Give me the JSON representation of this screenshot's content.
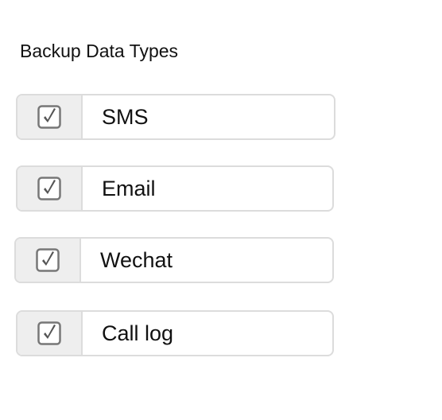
{
  "section": {
    "title": "Backup Data Types"
  },
  "options": [
    {
      "label": "SMS",
      "checked": true
    },
    {
      "label": "Email",
      "checked": true
    },
    {
      "label": "Wechat",
      "checked": true
    },
    {
      "label": "Call log",
      "checked": true
    }
  ],
  "icons": {
    "checkbox": "checkbox-checked-icon"
  },
  "colors": {
    "border": "#dcdcdc",
    "addon_background": "#eeeeee",
    "checkbox_border": "#777777",
    "checkmark": "#555555",
    "text": "#111111"
  }
}
